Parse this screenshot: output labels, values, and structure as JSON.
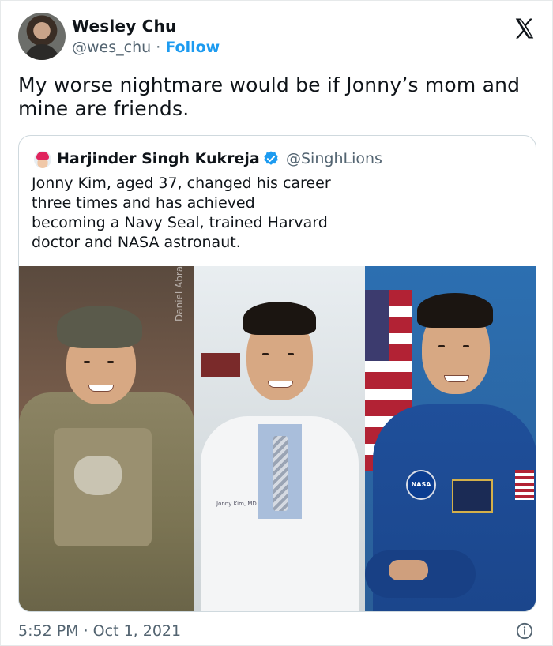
{
  "author": {
    "name": "Wesley Chu",
    "handle": "@wes_chu",
    "separator": "·",
    "follow_label": "Follow"
  },
  "tweet": {
    "text": "My worse nightmare would be if Jonny’s mom and mine are friends."
  },
  "quote": {
    "name": "Harjinder Singh Kukreja",
    "handle": "@SinghLions",
    "text": "Jonny Kim, aged 37, changed his career three times and has achieved becoming a Navy Seal, trained Harvard doctor and NASA astronaut.",
    "photo": {
      "watermark": "Daniel Abrahams",
      "coat_name": "Jonny Kim, MD",
      "nasa_patch": "NASA"
    }
  },
  "footer": {
    "timestamp": "5:52 PM · Oct 1, 2021"
  },
  "icons": {
    "close": "x-logo-icon",
    "verified": "verified-badge-icon",
    "info": "info-icon"
  },
  "colors": {
    "accent": "#1d9bf0",
    "secondary_text": "#536471",
    "border": "#cfd9de"
  }
}
